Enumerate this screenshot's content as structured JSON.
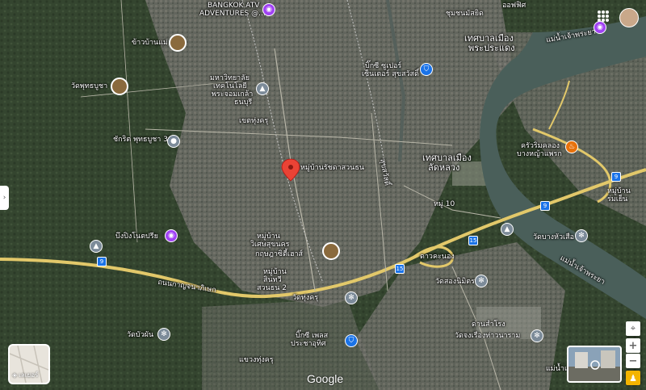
{
  "map": {
    "selected_place": "หมู่บ้านรัชดาสวนธน",
    "labels": [
      {
        "id": "bangkok-atv",
        "text": "BANGKOK ATV"
      },
      {
        "id": "atv-adventures",
        "text": "ADVENTURES @..."
      },
      {
        "id": "khao-ban-mae",
        "text": "ข้าวบ้านแม่"
      },
      {
        "id": "wat-phuttha-bucha",
        "text": "วัดพุทธบูชา"
      },
      {
        "id": "university-1",
        "text": "มหาวิทยาลัย"
      },
      {
        "id": "university-2",
        "text": "เทคโนโลยี"
      },
      {
        "id": "university-3",
        "text": "พระจอมเกล้า"
      },
      {
        "id": "university-4",
        "text": "ธนบุรี"
      },
      {
        "id": "khet-thung-khru",
        "text": "เขตทุ่งครุ"
      },
      {
        "id": "chakrit-36",
        "text": "ชักริต พุทธบูชา 36"
      },
      {
        "id": "big-c-1",
        "text": "บิ๊กซี ซูเปอร์"
      },
      {
        "id": "big-c-2",
        "text": "เซ็นเตอร์ สุขสวัสดิ์"
      },
      {
        "id": "thesaban-phra-pradaeng-1",
        "text": "เทศบาลเมือง"
      },
      {
        "id": "thesaban-phra-pradaeng-2",
        "text": "พระประแดง"
      },
      {
        "id": "khlong-bang-ya-phraek-1",
        "text": "ครัวริมคลอง"
      },
      {
        "id": "khlong-bang-ya-phraek-2",
        "text": "บางหญ้าแพรก"
      },
      {
        "id": "thesaban-lat-luang-1",
        "text": "เทศบาลเมือง"
      },
      {
        "id": "thesaban-lat-luang-2",
        "text": "ลัดหลวง"
      },
      {
        "id": "rachada-suan-thon",
        "text": "หมู่บ้านรัชดาสวนธน"
      },
      {
        "id": "muang-10",
        "text": "หมู่ 10"
      },
      {
        "id": "mu-ban-rom-yen-1",
        "text": "หมู่บ้าน"
      },
      {
        "id": "mu-ban-rom-yen-2",
        "text": "ร่มเย็น"
      },
      {
        "id": "bueng-ming-1",
        "text": "บึงปิงโนตปรีย"
      },
      {
        "id": "mu-ban-wiset-1",
        "text": "หมู่บ้าน"
      },
      {
        "id": "mu-ban-wiset-2",
        "text": "วิเศษสุขนคร"
      },
      {
        "id": "kritsada-city",
        "text": "กฤษฎาซิตี้เฮาส์"
      },
      {
        "id": "mu-ban-sanoe-1",
        "text": "หมู่บ้าน"
      },
      {
        "id": "mu-ban-sanoe-2",
        "text": "สินทวี"
      },
      {
        "id": "mu-ban-sanoe-3",
        "text": "สวนธน 2"
      },
      {
        "id": "wat-bang-hua-suea",
        "text": "วัดบางหัวเสือ"
      },
      {
        "id": "wat-thung-khru",
        "text": "วัดทุ่งครุ"
      },
      {
        "id": "wat-song-nimit",
        "text": "วัดสองนิมิตร"
      },
      {
        "id": "wat-bua-chan",
        "text": "วัดบัวผัน"
      },
      {
        "id": "big-c-place-1",
        "text": "บิ๊กซี เพลส"
      },
      {
        "id": "big-c-place-2",
        "text": "ประชาอุทิศ"
      },
      {
        "id": "dan-samrong",
        "text": "ด่านสำโรง"
      },
      {
        "id": "wat-dan-rueng",
        "text": "วัดจงเรืองท่าวนาราม"
      },
      {
        "id": "khwaeng-thung-khru",
        "text": "แขวงทุ่งครุ"
      },
      {
        "id": "soi-pracha-uthit",
        "text": "สุขสวัสดิ์"
      },
      {
        "id": "river-label-1",
        "text": "แม่น้ำเจ้าพระยา"
      },
      {
        "id": "river-label-2",
        "text": "แม่น้ำเจ้าพระยา"
      },
      {
        "id": "river-label-3",
        "text": "แม่น้ำเจ้า"
      },
      {
        "id": "kanchanaphisek",
        "text": "ถนนกาญจนาภิเษก"
      },
      {
        "id": "top-right-area",
        "text": "ชุมชนมัสยิด"
      },
      {
        "id": "top-right-area-2",
        "text": "ออฟฟิศ"
      },
      {
        "id": "dan-samrong-2",
        "text": "ดาวคะนอง"
      }
    ],
    "route_shields": [
      "9",
      "9",
      "9",
      "15",
      "15"
    ]
  },
  "controls": {
    "layers_label": "เลเยอร์",
    "google_logo": "Google",
    "zoom_in": "+",
    "zoom_out": "−"
  },
  "colors": {
    "highway": "#e2c86a",
    "river": "#4a5f5a",
    "pin": "#ea4335"
  }
}
